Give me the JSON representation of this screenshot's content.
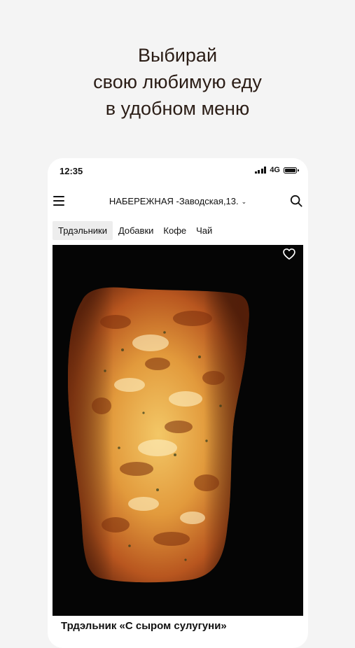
{
  "promo": {
    "line1": "Выбирай",
    "line2": "свою любимую еду",
    "line3": "в удобном меню"
  },
  "status_bar": {
    "time": "12:35",
    "network": "4G"
  },
  "header": {
    "location": "НАБЕРЕЖНАЯ -Заводская,13."
  },
  "tabs": [
    {
      "label": "Трдэльники",
      "active": true
    },
    {
      "label": "Добавки",
      "active": false
    },
    {
      "label": "Кофе",
      "active": false
    },
    {
      "label": "Чай",
      "active": false
    }
  ],
  "product": {
    "title": "Трдэльник «С сыром сулугуни»",
    "favorited": false
  },
  "colors": {
    "headline": "#2b1d16",
    "background": "#f4f4f4",
    "card_bg": "#000000",
    "active_tab_bg": "#ededed"
  }
}
